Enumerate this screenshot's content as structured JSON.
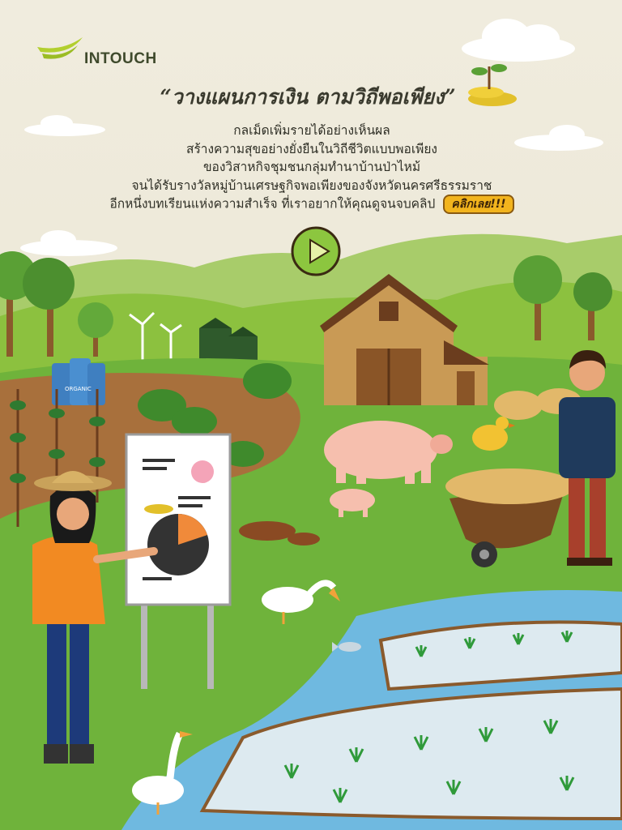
{
  "brand": {
    "name": "INTOUCH"
  },
  "headline": "“วางแผนการเงิน ตามวิถีพอเพียง”",
  "description": [
    "กลเม็ดเพิ่มรายได้อย่างเห็นผล",
    "สร้างความสุขอย่างยั่งยืนในวิถีชีวิตแบบพอเพียง",
    "ของวิสาหกิจชุมชนกลุ่มทำนาบ้านป่าไหม้",
    "จนได้รับรางวัลหมู่บ้านเศรษฐกิจพอเพียงของจังหวัดนครศรีธรรมราช",
    "อีกหนึ่งบทเรียนแห่งความสำเร็จ ที่เราอยากให้คุณดูจนจบคลิป"
  ],
  "cta_label": "คลิกเลย!!!",
  "organic_label": "ORGANIC",
  "colors": {
    "background": "#efebdc",
    "grass": "#6fb33b",
    "hill": "#8cc13f",
    "water": "#6fb9e0",
    "accent": "#f2b41d",
    "play_button": "#8cc63f"
  },
  "icons": [
    "play-icon",
    "intouch-logo-icon"
  ]
}
